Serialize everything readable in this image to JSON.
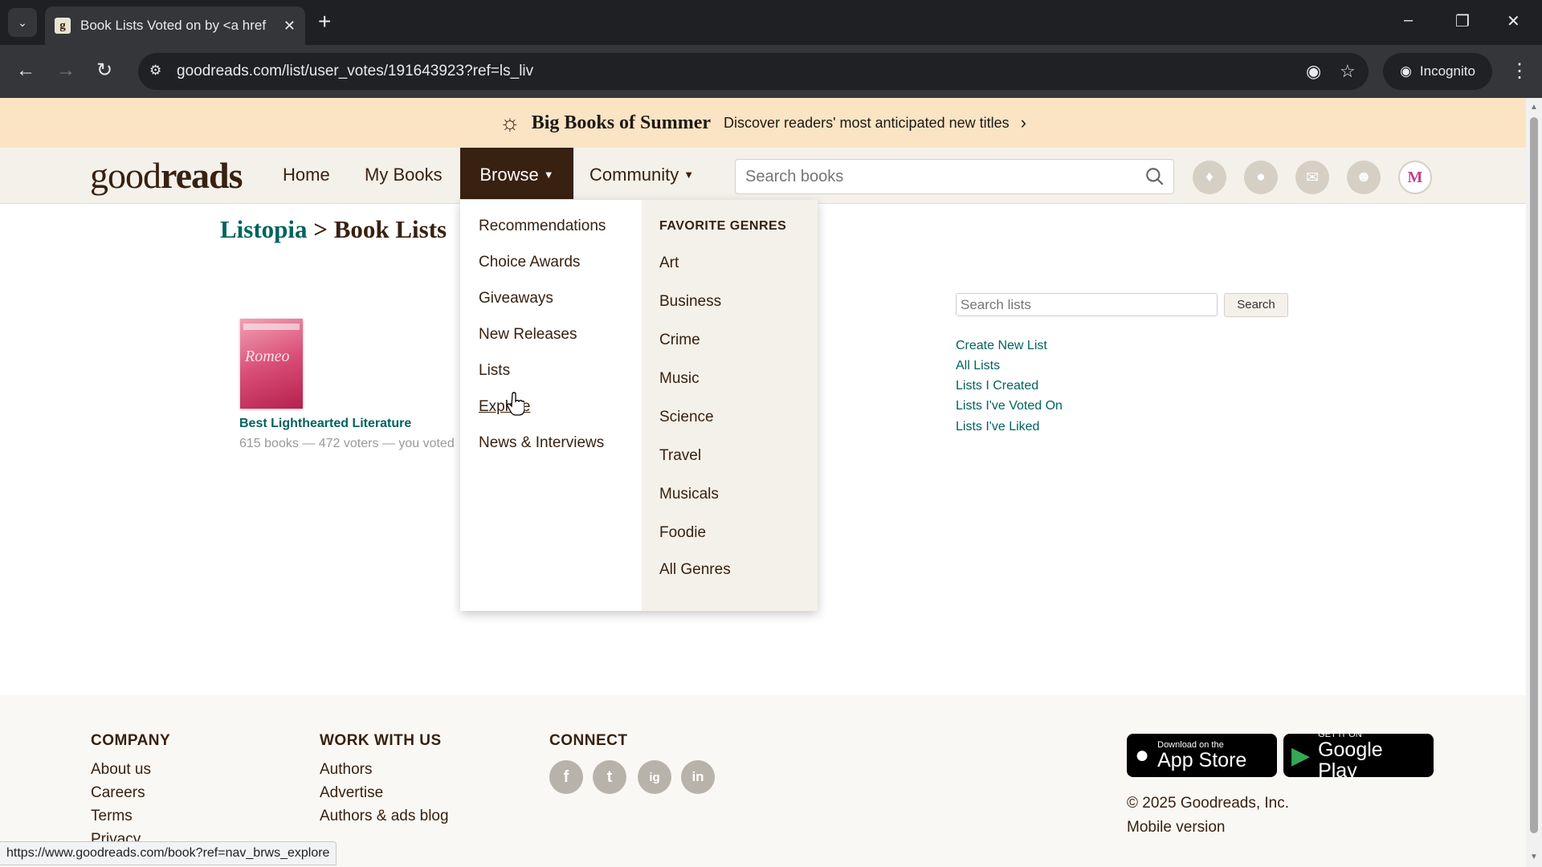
{
  "browser": {
    "tab_title": "Book Lists Voted on by <a href",
    "favicon": "g",
    "url": "goodreads.com/list/user_votes/191643923?ref=ls_liv",
    "incognito_label": "Incognito",
    "status_url": "https://www.goodreads.com/book?ref=nav_brws_explore"
  },
  "banner": {
    "title": "Big Books of Summer",
    "text": "Discover readers' most anticipated new titles"
  },
  "header": {
    "logo_light": "good",
    "logo_bold": "reads",
    "nav": {
      "home": "Home",
      "my_books": "My Books",
      "browse": "Browse",
      "community": "Community"
    },
    "search_placeholder": "Search books",
    "avatar_letter": "M"
  },
  "breadcrumb": {
    "root": "Listopia",
    "separator": ">",
    "current": "Book Lists"
  },
  "list": {
    "title": "Best Lighthearted Literature",
    "meta": "615 books — 472 voters — you voted"
  },
  "sidebar": {
    "search_placeholder": "Search lists",
    "search_button": "Search",
    "links": [
      "Create New List",
      "All Lists",
      "Lists I Created",
      "Lists I've Voted On",
      "Lists I've Liked"
    ]
  },
  "browse_menu": {
    "items": [
      "Recommendations",
      "Choice Awards",
      "Giveaways",
      "New Releases",
      "Lists",
      "Explore",
      "News & Interviews"
    ],
    "genres_heading": "FAVORITE GENRES",
    "genres": [
      "Art",
      "Business",
      "Crime",
      "Music",
      "Science",
      "Travel",
      "Musicals",
      "Foodie",
      "All Genres"
    ]
  },
  "footer": {
    "company": {
      "heading": "COMPANY",
      "links": [
        "About us",
        "Careers",
        "Terms",
        "Privacy"
      ]
    },
    "work": {
      "heading": "WORK WITH US",
      "links": [
        "Authors",
        "Advertise",
        "Authors & ads blog"
      ]
    },
    "connect": {
      "heading": "CONNECT",
      "social": [
        "f",
        "t",
        "ig",
        "in"
      ]
    },
    "app_store": {
      "small": "Download on the",
      "big": "App Store"
    },
    "google_play": {
      "small": "GET IT ON",
      "big": "Google Play"
    },
    "copyright": "© 2025 Goodreads, Inc.",
    "mobile": "Mobile version"
  },
  "colors": {
    "brand_brown": "#382110",
    "link_green": "#00635d",
    "header_bg": "#f4f1ea",
    "banner_bg": "#fae4c4"
  }
}
